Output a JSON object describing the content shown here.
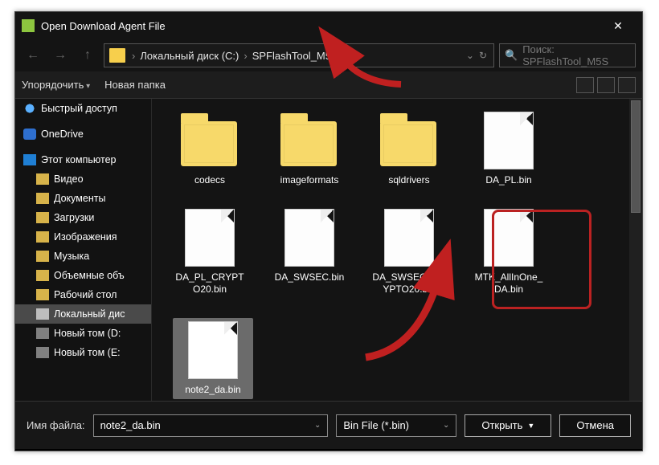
{
  "window": {
    "title": "Open Download Agent File"
  },
  "breadcrumb": {
    "drive": "Локальный диск (C:)",
    "folder": "SPFlashTool_M5S"
  },
  "search": {
    "placeholder": "Поиск: SPFlashTool_M5S"
  },
  "toolbar": {
    "organize": "Упорядочить",
    "newfolder": "Новая папка"
  },
  "sidebar": {
    "items": [
      {
        "label": "Быстрый доступ",
        "cls": "ico-star"
      },
      {
        "label": "OneDrive",
        "cls": "ico-cloud"
      },
      {
        "label": "Этот компьютер",
        "cls": "ico-pc"
      },
      {
        "label": "Видео",
        "cls": "ico-generic",
        "child": true
      },
      {
        "label": "Документы",
        "cls": "ico-generic",
        "child": true
      },
      {
        "label": "Загрузки",
        "cls": "ico-generic",
        "child": true
      },
      {
        "label": "Изображения",
        "cls": "ico-generic",
        "child": true
      },
      {
        "label": "Музыка",
        "cls": "ico-generic",
        "child": true
      },
      {
        "label": "Объемные объ",
        "cls": "ico-generic",
        "child": true
      },
      {
        "label": "Рабочий стол",
        "cls": "ico-generic",
        "child": true
      },
      {
        "label": "Локальный дис",
        "cls": "ico-disk",
        "child": true,
        "selected": true
      },
      {
        "label": "Новый том (D:",
        "cls": "ico-new",
        "child": true
      },
      {
        "label": "Новый том (E:",
        "cls": "ico-new",
        "child": true
      }
    ]
  },
  "files": {
    "items": [
      {
        "label": "codecs",
        "type": "folder"
      },
      {
        "label": "imageformats",
        "type": "folder"
      },
      {
        "label": "sqldrivers",
        "type": "folder"
      },
      {
        "label": "DA_PL.bin",
        "type": "file"
      },
      {
        "label": "DA_PL_CRYPTO20.bin",
        "type": "file"
      },
      {
        "label": "DA_SWSEC.bin",
        "type": "file"
      },
      {
        "label": "DA_SWSEC_CRYPTO20.bin",
        "type": "file"
      },
      {
        "label": "MTK_AllInOne_DA.bin",
        "type": "file"
      },
      {
        "label": "note2_da.bin",
        "type": "file",
        "selected": true
      }
    ]
  },
  "bottom": {
    "filename_label": "Имя файла:",
    "filename_value": "note2_da.bin",
    "type_value": "Bin File (*.bin)",
    "open": "Открыть",
    "cancel": "Отмена"
  },
  "colors": {
    "accent_red": "#c02020",
    "folder": "#f7d96a"
  }
}
